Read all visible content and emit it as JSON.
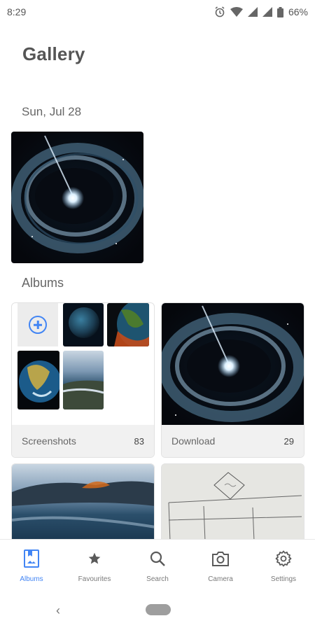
{
  "status_bar": {
    "time": "8:29",
    "battery": "66%",
    "icons": [
      "alarm-icon",
      "wifi-icon",
      "cell-signal-icon",
      "cell-signal-icon",
      "battery-icon"
    ]
  },
  "header": {
    "title": "Gallery"
  },
  "photos": {
    "date": "Sun, Jul 28"
  },
  "albums": {
    "heading": "Albums",
    "items": [
      {
        "name": "Screenshots",
        "count": "83"
      },
      {
        "name": "Download",
        "count": "29"
      }
    ]
  },
  "bottom_nav": {
    "items": [
      {
        "label": "Albums",
        "icon": "albums-icon",
        "active": true
      },
      {
        "label": "Favourites",
        "icon": "star-icon"
      },
      {
        "label": "Search",
        "icon": "search-icon"
      },
      {
        "label": "Camera",
        "icon": "camera-icon"
      },
      {
        "label": "Settings",
        "icon": "gear-icon"
      }
    ]
  },
  "colors": {
    "accent": "#4285f4",
    "footer_bg": "#f1f1f1"
  }
}
